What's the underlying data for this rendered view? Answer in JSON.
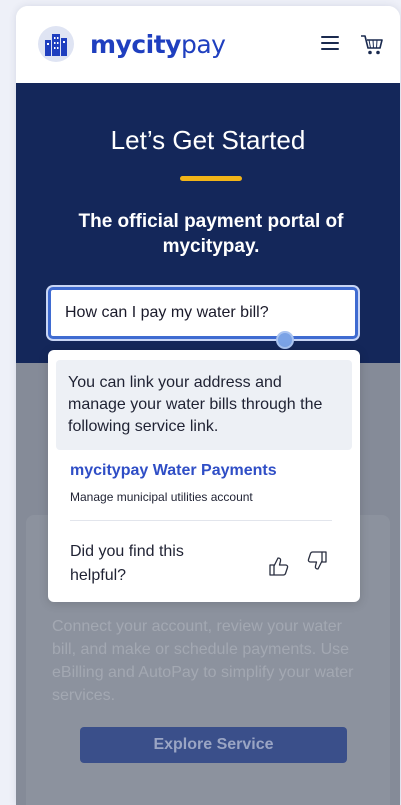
{
  "header": {
    "brand_bold": "mycity",
    "brand_regular": "pay",
    "logo_icon": "city-buildings-icon",
    "menu_icon": "hamburger-menu-icon",
    "cart_icon": "shopping-cart-icon"
  },
  "hero": {
    "title": "Let’s Get Started",
    "subtitle": "The official payment portal of mycitypay.",
    "search_value": "How can I pay my water bill?"
  },
  "chat_popup": {
    "answer": "You can link your address and manage your water bills through the following service link.",
    "link_label": "mycitypay Water Payments",
    "link_description": "Manage municipal utilities account",
    "feedback_question": "Did you find this helpful?",
    "thumbs_up_icon": "thumbs-up-icon",
    "thumbs_down_icon": "thumbs-down-icon"
  },
  "service_card": {
    "description": "Connect your account, review your water bill, and make or schedule payments. Use eBilling and AutoPay to simplify your water services.",
    "button_label": "Explore Service"
  },
  "colors": {
    "brand_blue": "#1f3fbf",
    "hero_navy": "#14275a",
    "accent_yellow": "#f2b418",
    "link_blue": "#2f4ec6"
  }
}
